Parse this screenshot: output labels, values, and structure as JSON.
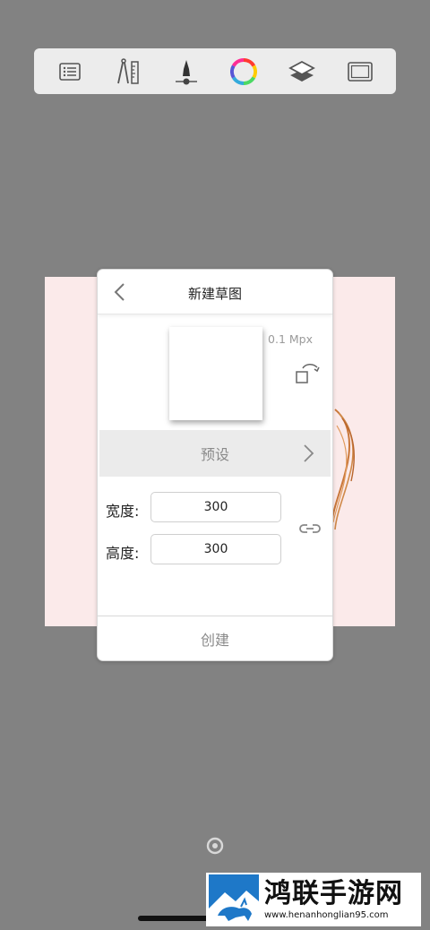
{
  "toolbar": {
    "items": [
      {
        "icon": "list-icon"
      },
      {
        "icon": "ruler-compass-icon"
      },
      {
        "icon": "brush-icon"
      },
      {
        "icon": "color-wheel-icon"
      },
      {
        "icon": "layers-icon"
      },
      {
        "icon": "canvas-frame-icon"
      }
    ]
  },
  "dialog": {
    "title": "新建草图",
    "resolution": "0.1 Mpx",
    "preset_label": "预设",
    "width_label": "宽度:",
    "width_value": "300",
    "height_label": "高度:",
    "height_value": "300",
    "create_label": "创建"
  },
  "watermark": {
    "title": "鸿联手游网",
    "url": "www.henanhonglian95.com"
  },
  "colors": {
    "background": "#828282",
    "toolbar": "#ececec",
    "canvas": "#fbeaea",
    "watermark_blue": "#1e78c8"
  }
}
